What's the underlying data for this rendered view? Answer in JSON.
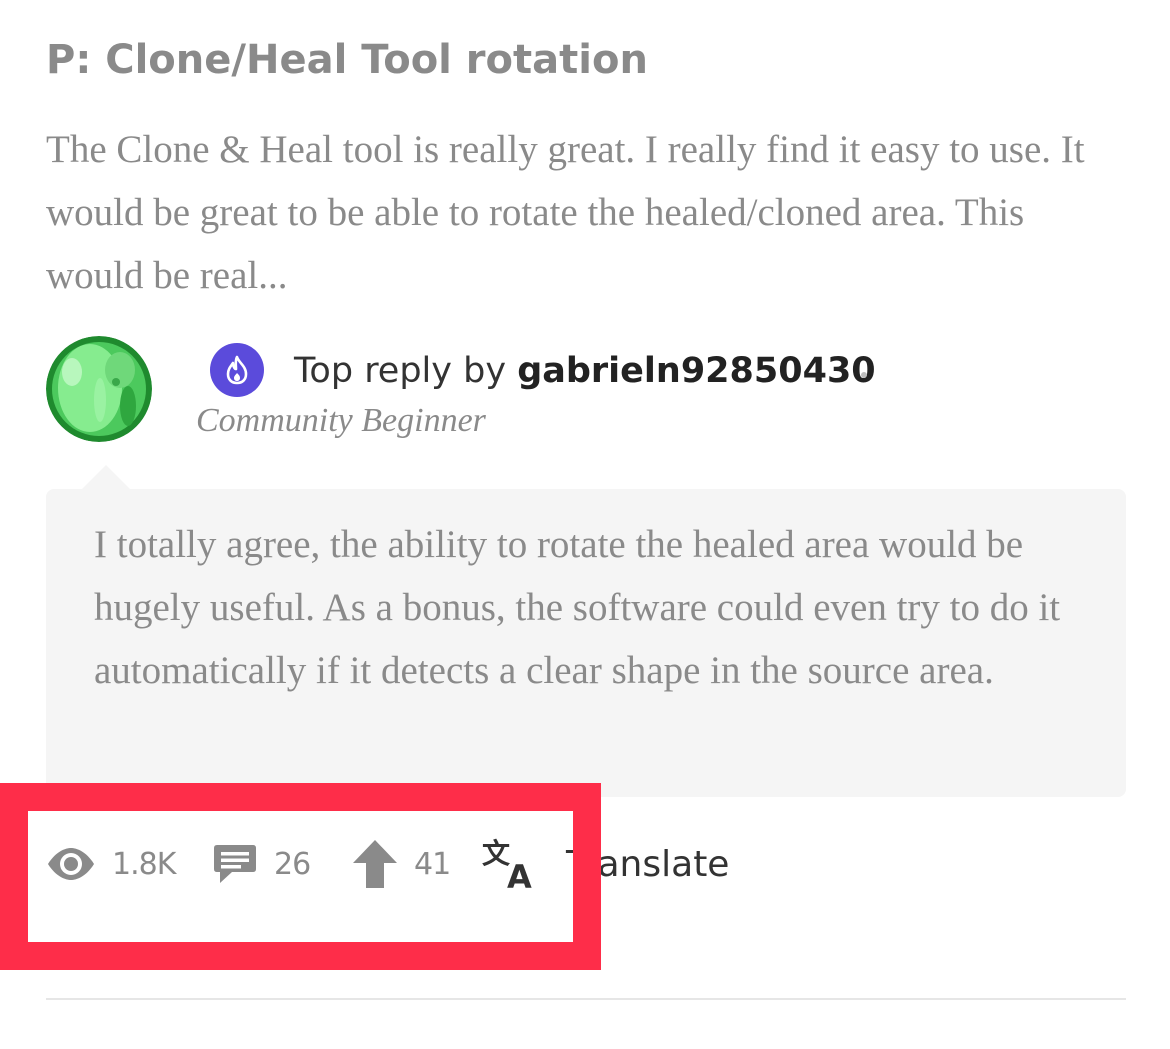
{
  "post": {
    "title": "P: Clone/Heal Tool rotation",
    "excerpt": "The Clone & Heal tool is really great. I really find it easy to use. It would be great to be able to rotate the healed/cloned area. This would be real..."
  },
  "top_reply": {
    "prefix": "Top reply by ",
    "username": "gabrieln92850430",
    "rank": "Community Beginner",
    "rank_icon": "flame-icon",
    "text": "I totally agree, the ability to rotate the healed area would be hugely useful. As a bonus, the software could even try to do it automatically if it detects a clear shape in the source area."
  },
  "stats": {
    "views": "1.8K",
    "comments": "26",
    "upvotes": "41",
    "translate_label": "Translate"
  },
  "colors": {
    "rank_badge": "#5b4bdb",
    "highlight": "#fe2d49",
    "bubble_bg": "#f5f5f5",
    "muted_text": "#8a8a8a"
  }
}
